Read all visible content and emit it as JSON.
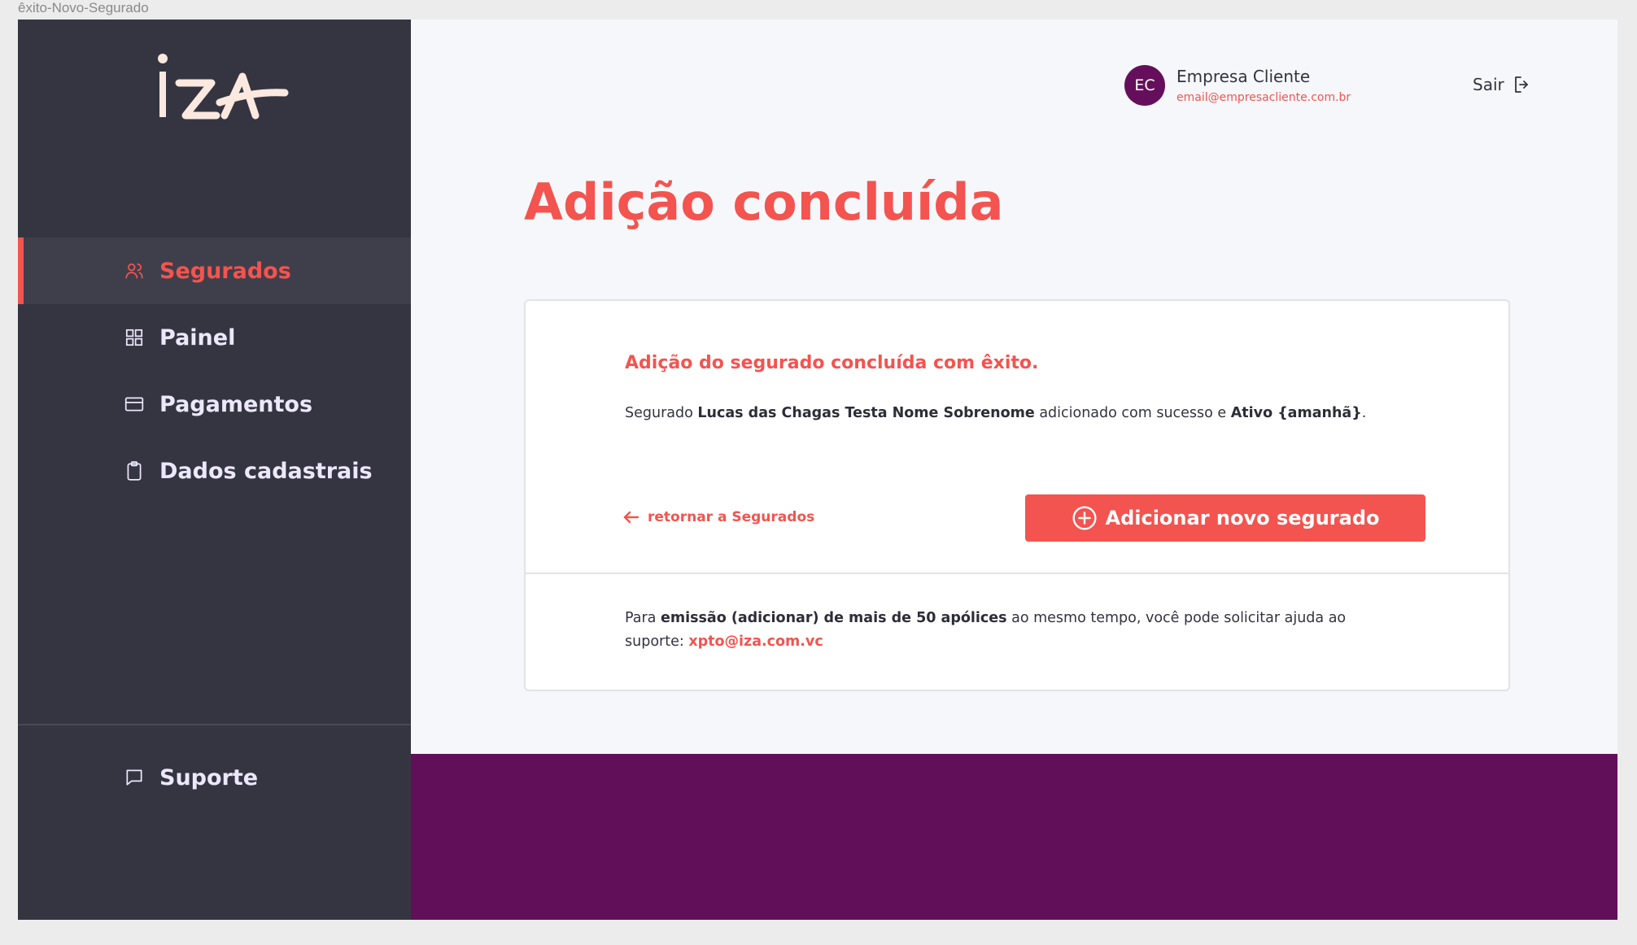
{
  "frame_label": "êxito-Novo-Segurado",
  "sidebar": {
    "logo_text": "iza",
    "items": [
      {
        "label": "Segurados",
        "icon": "users-icon",
        "active": true
      },
      {
        "label": "Painel",
        "icon": "grid-icon",
        "active": false
      },
      {
        "label": "Pagamentos",
        "icon": "credit-card-icon",
        "active": false
      },
      {
        "label": "Dados cadastrais",
        "icon": "clipboard-icon",
        "active": false
      }
    ],
    "support": {
      "label": "Suporte",
      "icon": "message-square-icon"
    }
  },
  "header": {
    "avatar_initials": "EC",
    "user_name": "Empresa Cliente",
    "user_email": "email@empresacliente.com.br",
    "logout_label": "Sair"
  },
  "page": {
    "title": "Adição concluída"
  },
  "card": {
    "heading": "Adição do segurado concluída com êxito.",
    "text_prefix": "Segurado ",
    "insured_name": "Lucas das Chagas Testa Nome Sobrenome",
    "text_middle": " adicionado com sucesso e ",
    "status": "Ativo {amanhã}",
    "text_suffix": ".",
    "back_link": "retornar a Segurados",
    "primary_button": "Adicionar novo segurado",
    "note_prefix": "Para ",
    "note_bold": "emissão (adicionar) de mais de 50 apólices",
    "note_middle": " ao mesmo tempo, você pode solicitar ajuda ao suporte: ",
    "note_email": "xpto@iza.com.vc"
  },
  "colors": {
    "accent": "#f3544f",
    "sidebar_bg": "#353541",
    "brand_purple": "#620f5a",
    "logo_cream": "#fbe8df"
  }
}
